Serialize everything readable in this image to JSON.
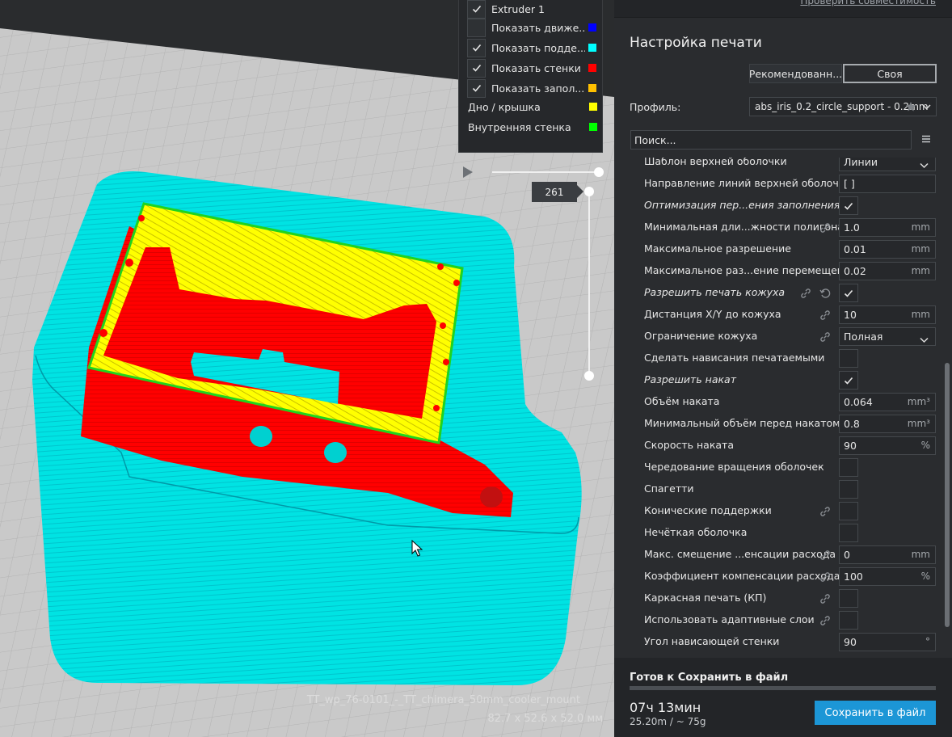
{
  "viewport": {
    "model_name": "TT_wp_76-0101_-_TT_chimera_50mm_cooler_mount",
    "model_dims": "82.7 x 52.6 x 52.0 мм",
    "layer_value": "261",
    "colors": {
      "cyan": "#00e8e8",
      "red": "#ff0000",
      "yellow": "#ffff00",
      "green": "#1fd41f"
    }
  },
  "legend": {
    "rows": [
      {
        "label": "Extruder 1",
        "checked": true,
        "color": ""
      },
      {
        "label": "Показать движе...",
        "checked": false,
        "color": "#0000ff"
      },
      {
        "label": "Показать подде...",
        "checked": true,
        "color": "#00ffff"
      },
      {
        "label": "Показать стенки",
        "checked": true,
        "color": "#ff0000"
      },
      {
        "label": "Показать запол...",
        "checked": true,
        "color": "#ffc000"
      }
    ],
    "plain_rows": [
      {
        "label": "Дно / крышка",
        "color": "#ffff00"
      },
      {
        "label": "Внутренняя стенка",
        "color": "#00ff00"
      }
    ]
  },
  "panel": {
    "compat_link": "Проверить совместимость",
    "title": "Настройка печати",
    "mode_recommended": "Рекомендованн...",
    "mode_custom": "Своя",
    "profile_label": "Профиль:",
    "profile_value": "abs_iris_0.2_circle_support - 0.2mm",
    "search_placeholder": "Поиск..."
  },
  "settings": [
    {
      "label": "Шаблон верхней оболочки",
      "type": "select",
      "value": "Линии",
      "italic": false
    },
    {
      "label": "Направление линий верхней оболочки",
      "type": "text",
      "value": "[ ]",
      "unit": "",
      "italic": false
    },
    {
      "label": "Оптимизация пер...ения заполнения",
      "type": "check",
      "checked": true,
      "italic": true
    },
    {
      "label": "Минимальная дли...жности полигона",
      "type": "text",
      "value": "1.0",
      "unit": "mm",
      "link": true
    },
    {
      "label": "Максимальное разрешение",
      "type": "text",
      "value": "0.01",
      "unit": "mm"
    },
    {
      "label": "Максимальное раз...ение перемещения",
      "type": "text",
      "value": "0.02",
      "unit": "mm"
    },
    {
      "label": "Разрешить печать кожуха",
      "type": "check",
      "checked": true,
      "italic": true,
      "link": true,
      "reset": true
    },
    {
      "label": "Дистанция X/Y до кожуха",
      "type": "text",
      "value": "10",
      "unit": "mm",
      "link": true
    },
    {
      "label": "Ограничение кожуха",
      "type": "select",
      "value": "Полная",
      "link": true
    },
    {
      "label": "Сделать нависания печатаемыми",
      "type": "check",
      "checked": false
    },
    {
      "label": "Разрешить накат",
      "type": "check",
      "checked": true,
      "italic": true
    },
    {
      "label": "Объём наката",
      "type": "text",
      "value": "0.064",
      "unit": "mm³"
    },
    {
      "label": "Минимальный объём перед накатом",
      "type": "text",
      "value": "0.8",
      "unit": "mm³"
    },
    {
      "label": "Скорость наката",
      "type": "text",
      "value": "90",
      "unit": "%"
    },
    {
      "label": "Чередование вращения оболочек",
      "type": "check",
      "checked": false
    },
    {
      "label": "Спагетти",
      "type": "check",
      "checked": false
    },
    {
      "label": "Конические поддержки",
      "type": "check",
      "checked": false,
      "link": true
    },
    {
      "label": "Нечёткая оболочка",
      "type": "check",
      "checked": false
    },
    {
      "label": "Макс. смещение ...енсации расхода",
      "type": "text",
      "value": "0",
      "unit": "mm",
      "link": true
    },
    {
      "label": "Коэффициент компенсации расхода",
      "type": "text",
      "value": "100",
      "unit": "%",
      "link": true
    },
    {
      "label": "Каркасная печать (КП)",
      "type": "check",
      "checked": false,
      "link": true
    },
    {
      "label": "Использовать адаптивные слои",
      "type": "check",
      "checked": false,
      "link": true
    },
    {
      "label": "Угол нависающей стенки",
      "type": "text",
      "value": "90",
      "unit": "°"
    }
  ],
  "bottom": {
    "ready": "Готов к Сохранить в файл",
    "time": "07ч 13мин",
    "material": "25.20m / ~ 75g",
    "save": "Сохранить в файл"
  }
}
